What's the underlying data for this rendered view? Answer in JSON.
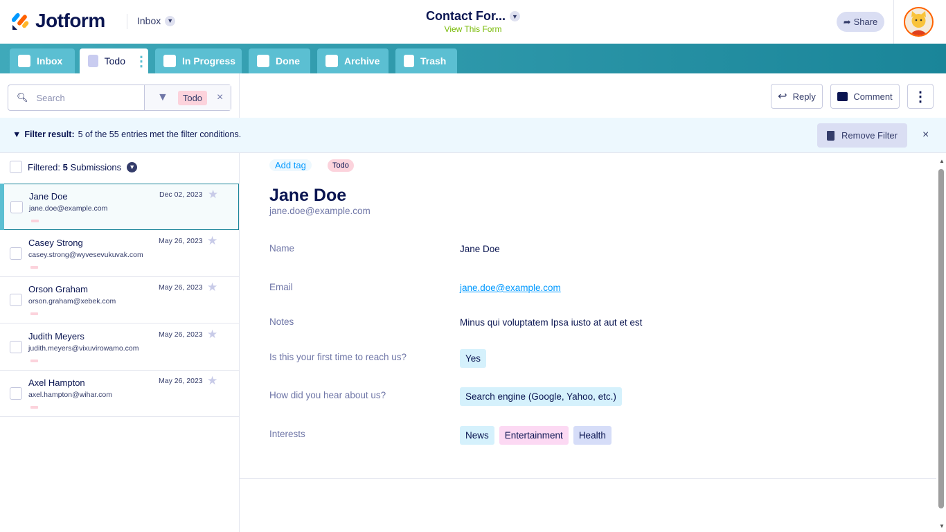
{
  "header": {
    "brand": "Jotform",
    "inbox_selector": "Inbox",
    "form_title": "Contact For...",
    "view_form": "View This Form",
    "share": "Share"
  },
  "tabs": [
    {
      "label": "Inbox"
    },
    {
      "label": "Todo"
    },
    {
      "label": "In Progress"
    },
    {
      "label": "Done"
    },
    {
      "label": "Archive"
    },
    {
      "label": "Trash"
    }
  ],
  "search": {
    "placeholder": "Search",
    "filter_chip": "Todo",
    "clear": "×"
  },
  "toolbar": {
    "reply": "Reply",
    "comment": "Comment",
    "more": "⋮"
  },
  "banner": {
    "label": "Filter result:",
    "text": "5 of the 55 entries met the filter conditions.",
    "remove": "Remove Filter",
    "close": "×"
  },
  "list": {
    "prefix": "Filtered:",
    "count": "5",
    "suffix": "Submissions",
    "items": [
      {
        "name": "Jane Doe",
        "email": "jane.doe@example.com",
        "date": "Dec 02, 2023"
      },
      {
        "name": "Casey Strong",
        "email": "casey.strong@wyvesevukuvak.com",
        "date": "May 26, 2023"
      },
      {
        "name": "Orson Graham",
        "email": "orson.graham@xebek.com",
        "date": "May 26, 2023"
      },
      {
        "name": "Judith Meyers",
        "email": "judith.meyers@vixuvirowamo.com",
        "date": "May 26, 2023"
      },
      {
        "name": "Axel Hampton",
        "email": "axel.hampton@wihar.com",
        "date": "May 26, 2023"
      }
    ]
  },
  "detail": {
    "add_tag": "Add tag",
    "tag": "Todo",
    "name": "Jane Doe",
    "email": "jane.doe@example.com",
    "fields": [
      {
        "label": "Name",
        "value": "Jane Doe"
      },
      {
        "label": "Email",
        "value": "jane.doe@example.com"
      },
      {
        "label": "Notes",
        "value": "Minus qui voluptatem Ipsa iusto at aut et est"
      },
      {
        "label": "Is this your first time to reach us?",
        "value": "Yes"
      },
      {
        "label": "How did you hear about us?",
        "value": "Search engine (Google, Yahoo, etc.)"
      },
      {
        "label": "Interests",
        "values": [
          "News",
          "Entertainment",
          "Health"
        ]
      }
    ]
  },
  "colors": {
    "teal": "#1a8599",
    "tab": "#5bbfd2",
    "navy": "#0a1551",
    "pink": "#fcd3dc",
    "link": "#0099ff"
  }
}
